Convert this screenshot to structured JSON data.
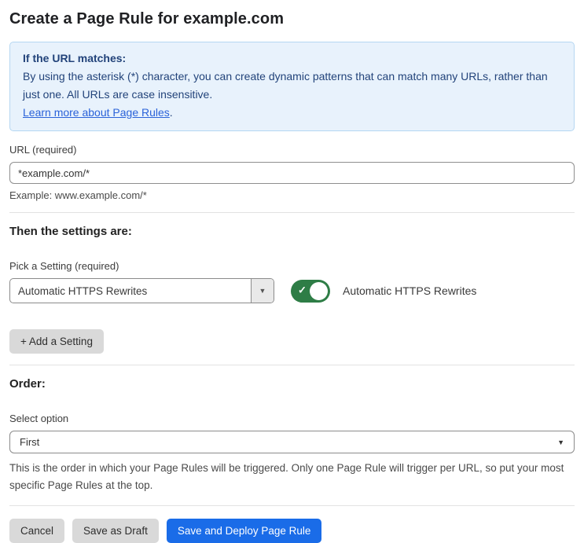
{
  "page": {
    "title": "Create a Page Rule for example.com"
  },
  "info_box": {
    "heading": "If the URL matches:",
    "body": "By using the asterisk (*) character, you can create dynamic patterns that can match many URLs, rather than just one. All URLs are case insensitive.",
    "link_label": "Learn more about Page Rules",
    "link_suffix": "."
  },
  "url_section": {
    "label": "URL (required)",
    "value": "*example.com/*",
    "helper": "Example: www.example.com/*"
  },
  "settings_section": {
    "heading": "Then the settings are:",
    "picker_label": "Pick a Setting (required)",
    "picker_value": "Automatic HTTPS Rewrites",
    "picker_arrow_icon": "▼",
    "toggle_state": "on",
    "toggle_check_icon": "✓",
    "toggle_label": "Automatic HTTPS Rewrites",
    "add_setting_label": "+ Add a Setting"
  },
  "order_section": {
    "heading": "Order:",
    "select_label": "Select option",
    "select_value": "First",
    "select_arrow_icon": "▼",
    "helper": "This is the order in which your Page Rules will be triggered. Only one Page Rule will trigger per URL, so put your most specific Page Rules at the top."
  },
  "footer": {
    "cancel_label": "Cancel",
    "save_draft_label": "Save as Draft",
    "save_deploy_label": "Save and Deploy Page Rule"
  },
  "colors": {
    "accent_blue": "#1a6ce8",
    "info_bg": "#e8f2fc",
    "info_border": "#b5d7f2",
    "info_text": "#22437a",
    "link_blue": "#2a62d9",
    "toggle_green": "#2e7d46",
    "button_gray": "#d9d9d9"
  }
}
